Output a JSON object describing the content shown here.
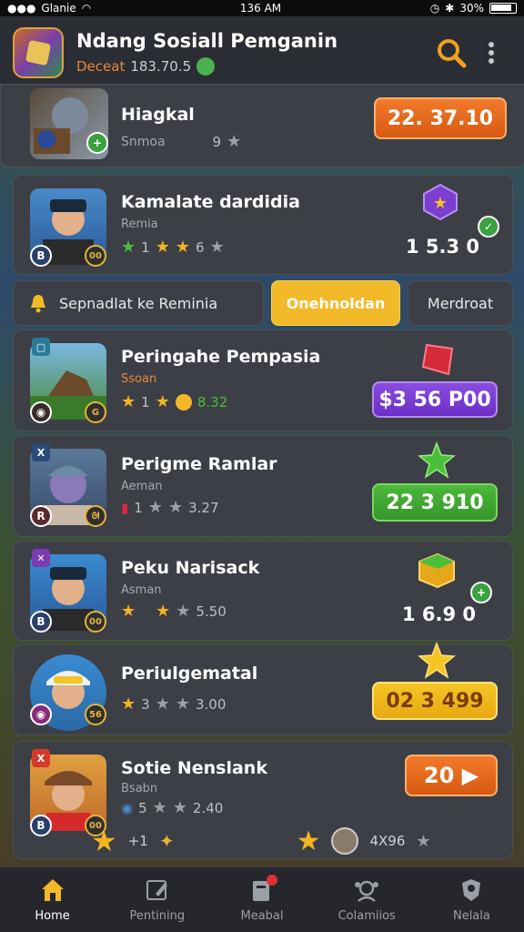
{
  "status": {
    "carrier": "Glanie",
    "time": "136 AM",
    "battery": "30%"
  },
  "header": {
    "title": "Ndang Sosiall Pemganin",
    "subtitle_label": "Deceat",
    "subtitle_value": "183.70.5"
  },
  "filters": {
    "notice": "Sepnadlat ke Reminia",
    "tab_active": "Onehnoldan",
    "tab_other": "Merdroat"
  },
  "cards": [
    {
      "name": "Hiagkal",
      "sub": "Snmoa",
      "rating": "9",
      "button": "22. 37.10"
    },
    {
      "name": "Kamalate dardidia",
      "sub": "Remia",
      "rating_a": "1",
      "rating_b": "6",
      "price": "1 5.3 0",
      "badge_l": "B",
      "badge_r": "00"
    },
    {
      "name": "Peringahe Pempasia",
      "sub": "Ssoan",
      "rating": "8.32",
      "button": "$3 56 P00",
      "badge_r": "G"
    },
    {
      "name": "Perigme Ramlar",
      "sub": "Aeman",
      "rating_a": "1",
      "rating": "3.27",
      "button": "22 3 910",
      "badge_l": "R",
      "tag": "X"
    },
    {
      "name": "Peku Narisack",
      "sub": "Asman",
      "rating": "5.50",
      "price": "1 6.9 0",
      "badge_l": "B",
      "badge_r": "00"
    },
    {
      "name": "Periulgematal",
      "sub": "",
      "rating_a": "3",
      "rating": "3.00",
      "button": "02 3 499",
      "badge_r": "56"
    },
    {
      "name": "Sotie Nenslank",
      "sub": "Bsabn",
      "rating_a": "5",
      "rating": "2.40",
      "button": "20 ▶",
      "badge_l": "B",
      "badge_r": "00",
      "tag": "X"
    }
  ],
  "footer_row": {
    "count": "+1",
    "total": "4X96"
  },
  "nav": [
    {
      "label": "Home"
    },
    {
      "label": "Pentining"
    },
    {
      "label": "Meabal"
    },
    {
      "label": "Colamiios"
    },
    {
      "label": "Nelala"
    }
  ]
}
